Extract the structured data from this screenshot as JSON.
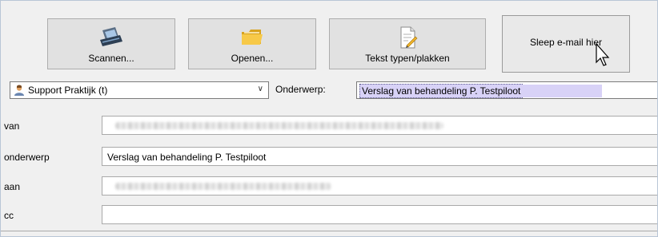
{
  "toolbar": {
    "scan_label": "Scannen...",
    "open_label": "Openen...",
    "text_label": "Tekst typen/plakken",
    "drop_label": "Sleep e-mail hier"
  },
  "sender": {
    "value": "Support Praktijk (t)",
    "icon": "user-icon"
  },
  "subject": {
    "label": "Onderwerp:",
    "value": "Verslag van behandeling P. Testpiloot"
  },
  "fields": {
    "van_label": "van",
    "onderwerp_label": "onderwerp",
    "onderwerp_value": "Verslag van behandeling P. Testpiloot",
    "aan_label": "aan",
    "cc_label": "cc"
  },
  "colors": {
    "selection": "#d8d2f7",
    "button_face": "#e1e1e1"
  }
}
